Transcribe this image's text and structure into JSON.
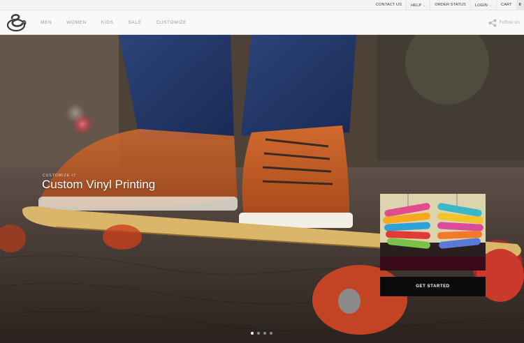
{
  "utility_bar": {
    "contact": "CONTACT US",
    "help": "HELP",
    "order_status": "ORDER STATUS",
    "login": "LOGIN",
    "cart": "CART",
    "cart_count": "0"
  },
  "nav": {
    "items": [
      {
        "label": "MEN"
      },
      {
        "label": "WOMEN"
      },
      {
        "label": "KIDS"
      },
      {
        "label": "SALE"
      },
      {
        "label": "CUSTOMIZE"
      }
    ],
    "follow_label": "Follow us"
  },
  "hero": {
    "kicker": "CUSTOMIZE IT",
    "title": "Custom Vinyl Printing",
    "cta": "GET STARTED",
    "slide_count": 4,
    "active_slide": 1
  },
  "colors": {
    "accent_dark": "#0b0b0b",
    "nav_text": "#999999"
  },
  "icons": [
    "logo-icon",
    "share-icon",
    "caret-down-icon"
  ]
}
